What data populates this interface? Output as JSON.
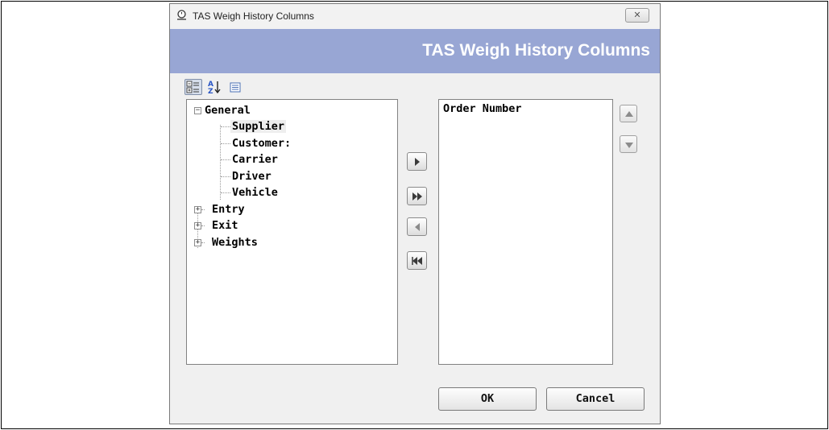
{
  "window": {
    "title": "TAS Weigh History Columns",
    "close_glyph": "✕",
    "banner_title": "TAS Weigh History Columns",
    "banner_color": "#98a6d4"
  },
  "toolbar": {
    "categorized_icon": "categorized-view-icon",
    "alphabetical_icon": "sort-alphabetical-icon",
    "pages_icon": "property-pages-icon"
  },
  "tree": {
    "groups": [
      {
        "label": "General",
        "expanded": true,
        "expander": "−",
        "children": [
          {
            "label": "Supplier",
            "selected": true
          },
          {
            "label": "Customer:"
          },
          {
            "label": "Carrier"
          },
          {
            "label": "Driver"
          },
          {
            "label": "Vehicle"
          }
        ]
      },
      {
        "label": "Entry",
        "expanded": false,
        "expander": "+"
      },
      {
        "label": "Exit",
        "expanded": false,
        "expander": "+"
      },
      {
        "label": "Weights",
        "expanded": false,
        "expander": "+"
      }
    ]
  },
  "transfer_buttons": [
    {
      "name": "add-selected",
      "icon": "arrow-right-icon"
    },
    {
      "name": "add-all",
      "icon": "double-arrow-right-icon"
    },
    {
      "name": "remove-selected",
      "icon": "arrow-left-icon"
    },
    {
      "name": "remove-all",
      "icon": "double-arrow-left-icon"
    }
  ],
  "selected_columns": [
    "Order Number"
  ],
  "order_buttons": {
    "up_icon": "move-up-icon",
    "down_icon": "move-down-icon"
  },
  "buttons": {
    "ok": "OK",
    "cancel": "Cancel"
  }
}
